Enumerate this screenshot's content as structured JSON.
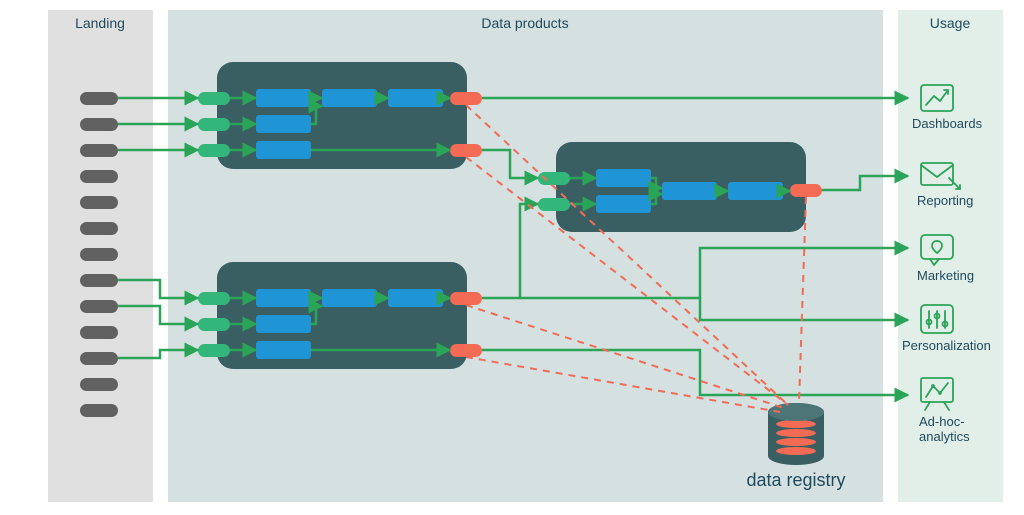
{
  "regions": {
    "landing": "Landing",
    "products": "Data products",
    "usage": "Usage"
  },
  "registry_label": "data registry",
  "usage_targets": [
    {
      "key": "dashboards",
      "label": "Dashboards"
    },
    {
      "key": "reporting",
      "label": "Reporting"
    },
    {
      "key": "marketing",
      "label": "Marketing"
    },
    {
      "key": "personalization",
      "label": "Personalization"
    },
    {
      "key": "adhoc",
      "label": "Ad-hoc-\nanalytics"
    }
  ],
  "colors": {
    "landing_bg": "#e0e0e0",
    "products_bg": "#d5e0e1",
    "usage_bg": "#e2efe9",
    "product_box": "#3a5f63",
    "landing_pill": "#616161",
    "input_pill": "#33b67a",
    "output_pill": "#f36b55",
    "stage": "#1f95d6",
    "flow": "#2aa457",
    "registry_dash": "#f36b55",
    "text": "#1f4a5c"
  }
}
